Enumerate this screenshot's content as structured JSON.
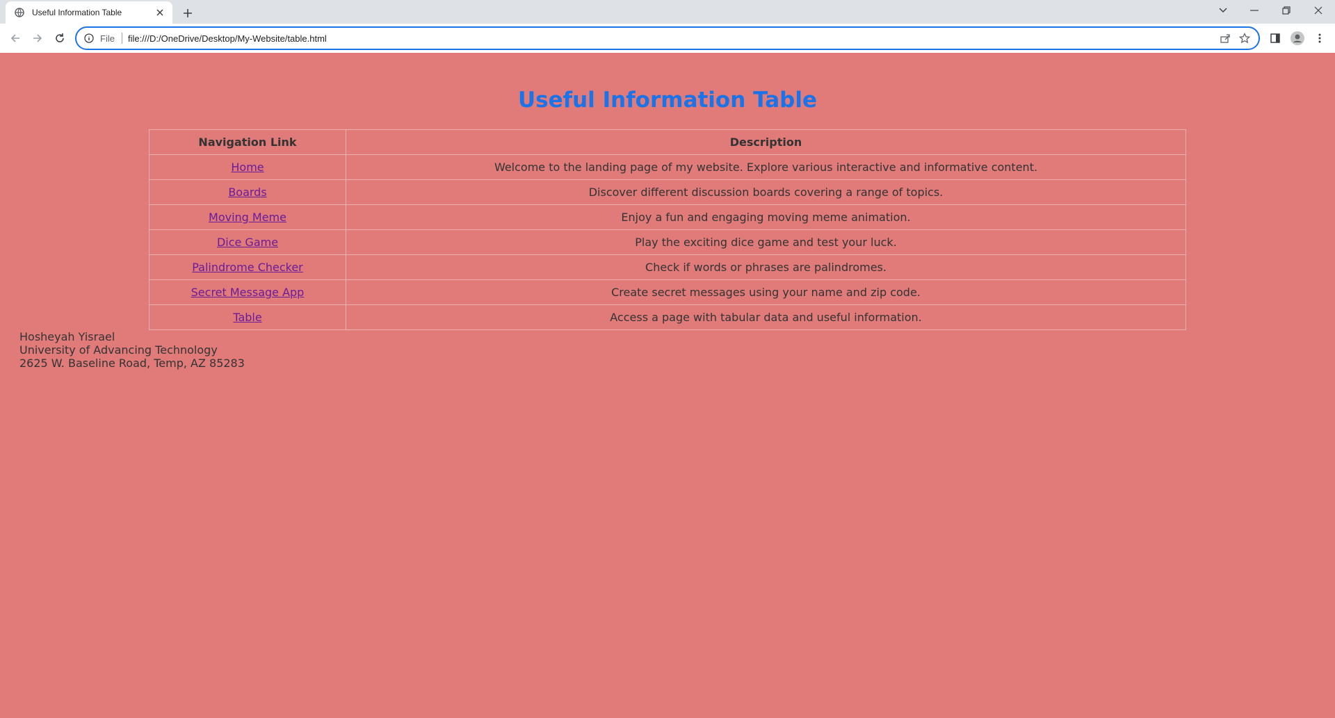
{
  "browser": {
    "tab_title": "Useful Information Table",
    "scheme_label": "File",
    "url": "file:///D:/OneDrive/Desktop/My-Website/table.html"
  },
  "page": {
    "heading": "Useful Information Table",
    "heading_color": "#1a73e8",
    "background_color": "#e07b7a",
    "table": {
      "headers": [
        "Navigation Link",
        "Description"
      ],
      "rows": [
        {
          "link": "Home",
          "description": "Welcome to the landing page of my website. Explore various interactive and informative content."
        },
        {
          "link": "Boards",
          "description": "Discover different discussion boards covering a range of topics."
        },
        {
          "link": "Moving Meme",
          "description": "Enjoy a fun and engaging moving meme animation."
        },
        {
          "link": "Dice Game",
          "description": "Play the exciting dice game and test your luck."
        },
        {
          "link": "Palindrome Checker",
          "description": "Check if words or phrases are palindromes."
        },
        {
          "link": "Secret Message App",
          "description": "Create secret messages using your name and zip code."
        },
        {
          "link": "Table",
          "description": "Access a page with tabular data and useful information."
        }
      ]
    },
    "footer": {
      "name": "Hosheyah Yisrael",
      "school": "University of Advancing Technology",
      "address": "2625 W. Baseline Road, Temp, AZ 85283"
    }
  }
}
